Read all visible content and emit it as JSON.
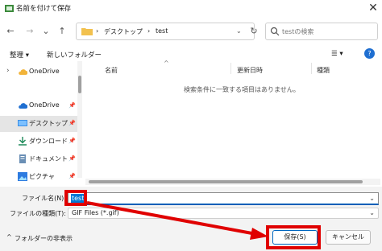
{
  "window": {
    "title": "名前を付けて保存",
    "close_glyph": "✕"
  },
  "nav": {
    "back": "←",
    "forward": "→",
    "dropdown": "⌄",
    "up": "↑",
    "refresh": "↻"
  },
  "address": {
    "sep1": "›",
    "crumb1": "デスクトップ",
    "sep2": "›",
    "crumb2": "test",
    "chev": "⌄"
  },
  "search": {
    "placeholder": "testの検索"
  },
  "toolbar": {
    "organize": "整理 ▾",
    "new_folder": "新しいフォルダー",
    "view": "☰ ▾",
    "help": "?"
  },
  "sidebar": {
    "items": [
      {
        "label": "OneDrive",
        "icon": "cloud-icon",
        "expander": "›"
      },
      {
        "label": "OneDrive",
        "icon": "cloud-icon"
      },
      {
        "label": "デスクトップ",
        "icon": "desktop-icon",
        "selected": true
      },
      {
        "label": "ダウンロード",
        "icon": "download-icon"
      },
      {
        "label": "ドキュメント",
        "icon": "document-icon"
      },
      {
        "label": "ピクチャ",
        "icon": "picture-icon"
      }
    ],
    "pin_glyph": "📌"
  },
  "columns": {
    "name": "名前",
    "modified": "更新日時",
    "type": "種類",
    "sort_caret": "^"
  },
  "empty_message": "検索条件に一致する項目はありません。",
  "filename": {
    "label": "ファイル名(N):",
    "value": "test"
  },
  "filetype": {
    "label": "ファイルの種類(T):",
    "value": "GIF Files (*.gif)",
    "arrow": "⌄"
  },
  "footer": {
    "hide_folders": "フォルダーの非表示",
    "caret": "^",
    "save": "保存(S)",
    "cancel": "キャンセル"
  },
  "colors": {
    "highlight": "#e00000",
    "accent": "#0078d4",
    "folder": "#f2c14e"
  }
}
